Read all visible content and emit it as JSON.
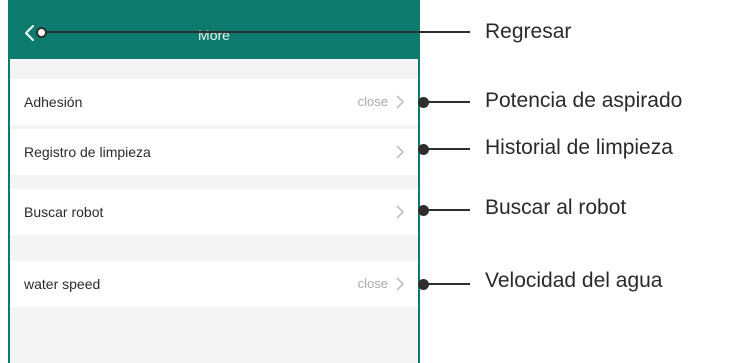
{
  "header": {
    "title": "More",
    "back_icon": "chevron-left-icon",
    "background": "#0d7a6e"
  },
  "rows": [
    {
      "label": "Adhesión",
      "value": "close"
    },
    {
      "label": "Registro de limpieza",
      "value": ""
    },
    {
      "label": "Buscar robot",
      "value": ""
    },
    {
      "label": "water speed",
      "value": "close"
    }
  ],
  "callouts": [
    "Regresar",
    "Potencia de aspirado",
    "Historial de limpieza",
    "Buscar al robot",
    "Velocidad del agua"
  ]
}
